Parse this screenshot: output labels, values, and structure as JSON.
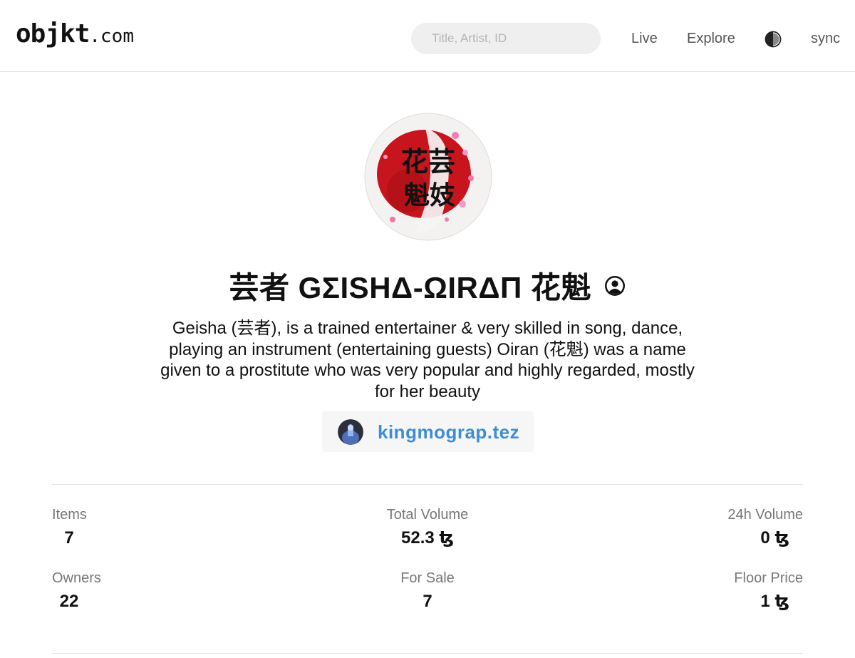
{
  "header": {
    "logo_main": "objkt",
    "logo_tld": ".com",
    "search_placeholder": "Title, Artist, ID",
    "nav": {
      "live": "Live",
      "explore": "Explore",
      "sync": "sync"
    },
    "theme_icon": "half-moon-contrast-icon"
  },
  "collection": {
    "avatar_icon": "collection-logo-image",
    "title": "芸者 GΣISHΔ-ΩIRΔΠ 花魁",
    "title_icon": "user-circle-icon",
    "description": "Geisha (芸者), is a trained entertainer & very skilled in song, dance, playing an instrument (entertaining guests) Oiran (花魁) was a name given to a prostitute who was very popular and highly regarded, mostly for her beauty",
    "creator": {
      "name": "kingmograp.tez",
      "avatar_icon": "creator-avatar-image"
    }
  },
  "stats": {
    "items": {
      "label": "Items",
      "value": "7"
    },
    "total_volume": {
      "label": "Total Volume",
      "value": "52.3 ꜩ"
    },
    "volume_24h": {
      "label": "24h Volume",
      "value": "0 ꜩ"
    },
    "owners": {
      "label": "Owners",
      "value": "22"
    },
    "for_sale": {
      "label": "For Sale",
      "value": "7"
    },
    "floor_price": {
      "label": "Floor Price",
      "value": "1 ꜩ"
    }
  },
  "colors": {
    "accent_link": "#3d8dd6",
    "logo_red": "#c8141c",
    "search_bg": "#efefef"
  }
}
